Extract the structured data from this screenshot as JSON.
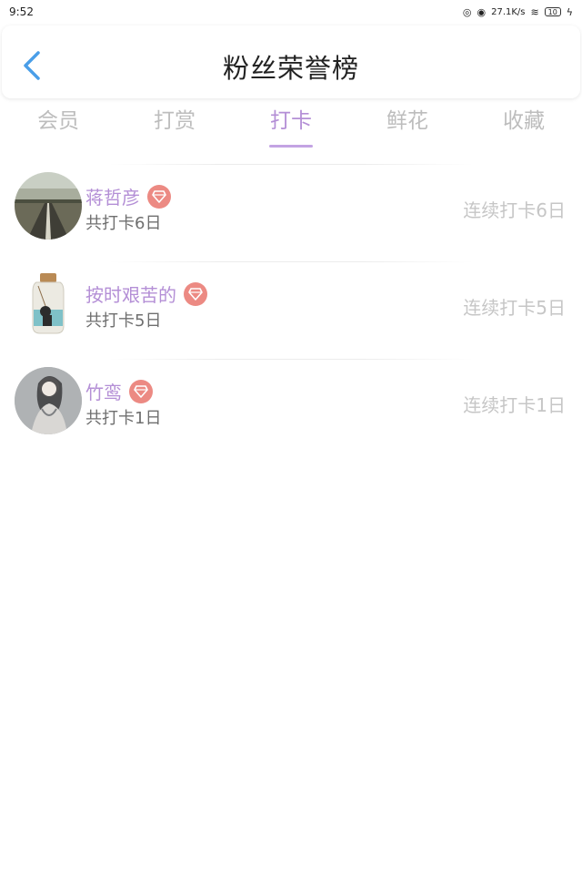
{
  "status_bar": {
    "time": "9:52",
    "network_speed": "27.1K/s",
    "battery": "10"
  },
  "header": {
    "title": "粉丝荣誉榜",
    "back_icon": "chevron-left-icon"
  },
  "colors": {
    "accent": "#b48fd6",
    "back": "#4a9ee8",
    "badge": "#ec8a83",
    "muted": "#c6c6c6"
  },
  "tabs": [
    {
      "label": "会员",
      "active": false
    },
    {
      "label": "打赏",
      "active": false
    },
    {
      "label": "打卡",
      "active": true
    },
    {
      "label": "鲜花",
      "active": false
    },
    {
      "label": "收藏",
      "active": false
    }
  ],
  "fans": [
    {
      "name": "蒋哲彦",
      "total": "共打卡6日",
      "streak": "连续打卡6日",
      "badge_icon": "diamond-icon"
    },
    {
      "name": "按时艰苦的",
      "total": "共打卡5日",
      "streak": "连续打卡5日",
      "badge_icon": "diamond-icon"
    },
    {
      "name": "竹鸾",
      "total": "共打卡1日",
      "streak": "连续打卡1日",
      "badge_icon": "diamond-icon"
    }
  ]
}
